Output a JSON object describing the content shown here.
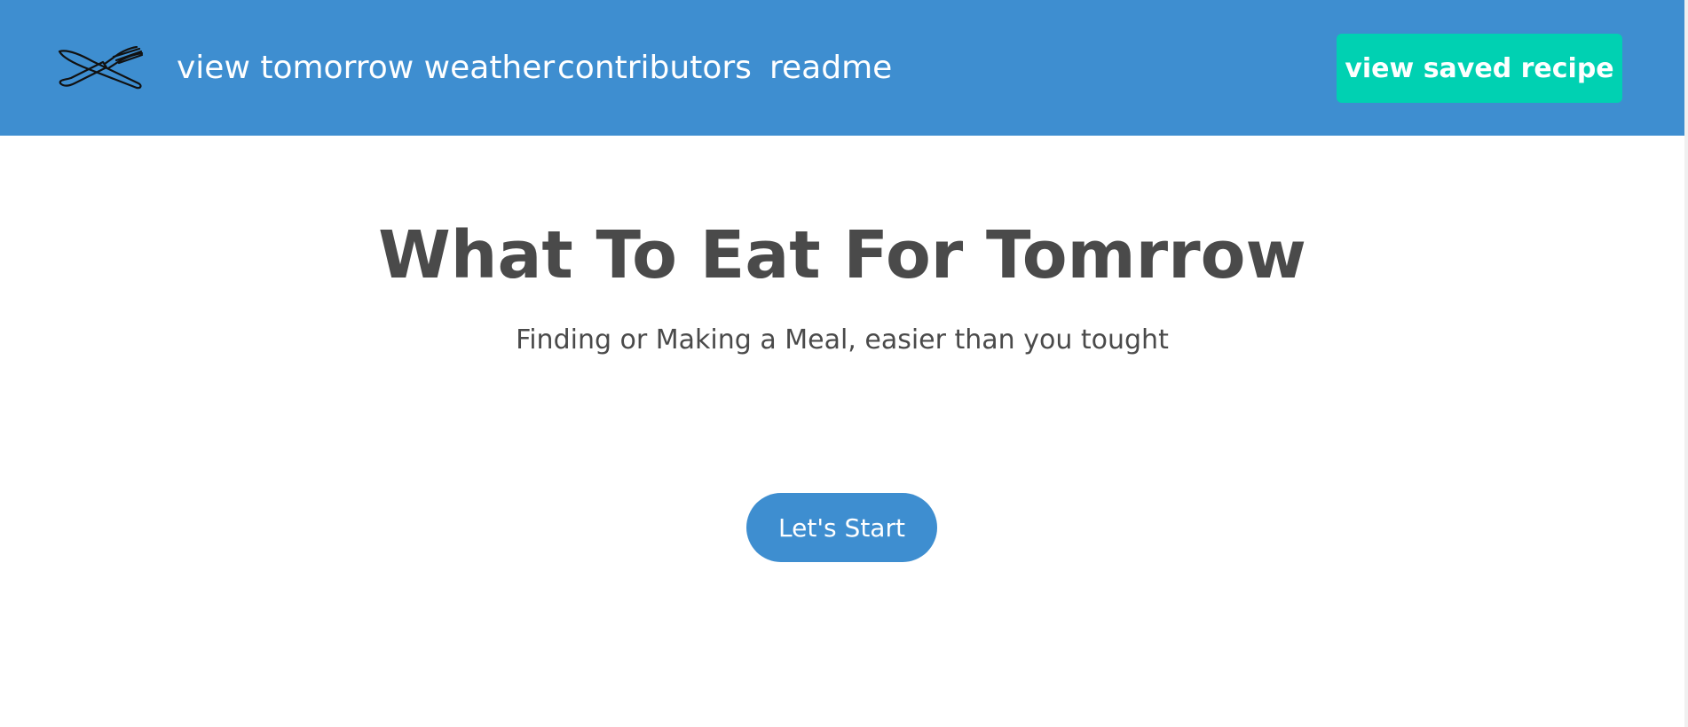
{
  "navbar": {
    "logo_icon": "crossed-knife-fork-icon",
    "links": [
      {
        "label": "view tomorrow weather"
      },
      {
        "label": "contributors"
      },
      {
        "label": "readme"
      }
    ],
    "saved_button_label": "view saved recipe"
  },
  "hero": {
    "title": "What To Eat For Tomrrow",
    "subtitle": "Finding or Making a Meal, easier than you tought",
    "start_button_label": "Let's Start"
  },
  "colors": {
    "navbar": "#3e8ed0",
    "saved_button": "#00d1b2",
    "start_button": "#3e8ed0",
    "text": "#4a4a4a"
  }
}
